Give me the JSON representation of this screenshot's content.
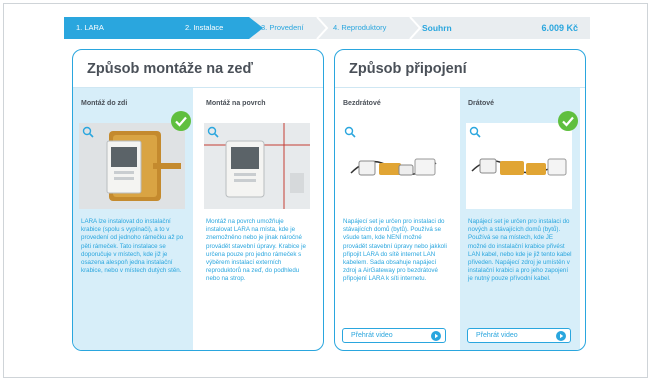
{
  "steps": [
    {
      "label": "1. LARA"
    },
    {
      "label": "2. Instalace"
    },
    {
      "label": "3. Provedení"
    },
    {
      "label": "4. Reproduktory"
    },
    {
      "label": "Souhrn"
    }
  ],
  "price": "6.009 Kč",
  "mount": {
    "title": "Způsob montáže na zeď",
    "options": [
      {
        "name": "Montáž do zdi",
        "selected": true,
        "description": "LARA lze instalovat do instalační krabice (spolu s vypínači), a to v provedení od jednoho rámečku až po pěti rámeček. Tato instalace se doporučuje v místech, kde již je osazena alespoň jedna instalační krabice, nebo v místech dutých stěn."
      },
      {
        "name": "Montáž na povrch",
        "selected": false,
        "description": "Montáž na povrch umožňuje instalovat LARA na místa, kde je znemožněno nebo je jinak náročné provádět stavební úpravy. Krabice je určena pouze pro jedno rámeček s výběrem instalací externích reproduktorů na zeď, do podhledu nebo na strop."
      }
    ]
  },
  "connection": {
    "title": "Způsob připojení",
    "options": [
      {
        "name": "Bezdrátové",
        "selected": false,
        "description": "Napájecí set je určen pro instalaci do stávajících domů (bytů). Používá se všude tam, kde NENÍ možné provádět stavební úpravy nebo jakkoli připojit LARA do sítě internet LAN kabelem. Sada obsahuje napájecí zdroj a AirGateway pro bezdrátové připojení LARA k síti internetu.",
        "video": "Přehrát video"
      },
      {
        "name": "Drátové",
        "selected": true,
        "description": "Napájecí set je určen pro instalaci do nových a stávajících domů (bytů). Používá se na místech, kde JE možné do instalační krabice přivést LAN kabel, nebo kde je již tento kabel přiveden. Napájecí zdroj je umístěn v instalační krabici a pro jeho zapojení je nutný pouze přívodní kabel.",
        "video": "Přehrát video"
      }
    ]
  },
  "colors": {
    "accent": "#2aa6de",
    "selected_bg": "#d7eef9",
    "check": "#5fbf3f"
  },
  "icons": [
    "zoom-icon",
    "check-icon",
    "play-icon"
  ]
}
